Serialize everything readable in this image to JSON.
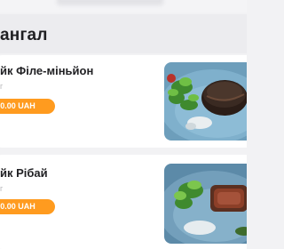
{
  "section": {
    "title": "ангал"
  },
  "items": [
    {
      "name": "йк Філе-міньйон",
      "weight": "г",
      "price": "0.00 UAH",
      "image": "steak-fillet-mignon-photo"
    },
    {
      "name": "йк Рібай",
      "weight": "г",
      "price": "0.00 UAH",
      "image": "steak-ribeye-photo"
    }
  ],
  "colors": {
    "accent": "#ff9b1f",
    "background": "#f2f2f4",
    "card": "#ffffff",
    "plate": "#6f9fbd"
  }
}
